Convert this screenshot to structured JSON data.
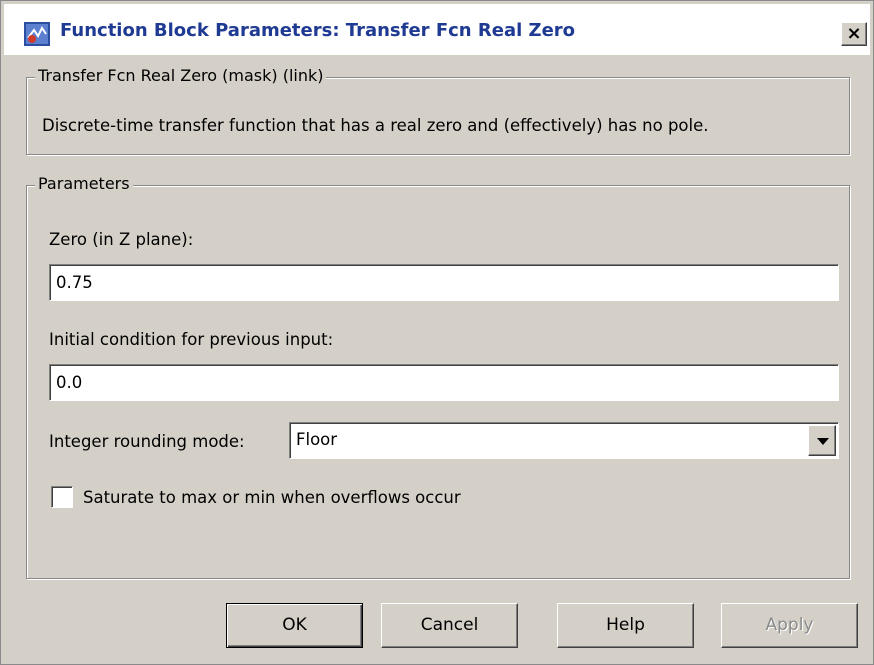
{
  "window": {
    "title": "Function Block Parameters: Transfer Fcn Real Zero",
    "close_label": "×"
  },
  "description_group": {
    "legend": "Transfer Fcn Real Zero (mask) (link)",
    "text": "Discrete-time transfer function that has a real zero and (effectively) has no pole."
  },
  "parameters_group": {
    "legend": "Parameters",
    "zero": {
      "label": "Zero (in Z plane):",
      "value": "0.75"
    },
    "initial_condition": {
      "label": "Initial condition for previous input:",
      "value": "0.0"
    },
    "rounding_mode": {
      "label": "Integer rounding mode:",
      "value": "Floor"
    },
    "saturate": {
      "label": "Saturate to max or min when overflows occur",
      "checked": false
    }
  },
  "buttons": {
    "ok": "OK",
    "cancel": "Cancel",
    "help": "Help",
    "apply": "Apply"
  },
  "icons": {
    "app": "simulink-block-icon",
    "close": "close-icon",
    "dropdown": "chevron-down-icon"
  }
}
